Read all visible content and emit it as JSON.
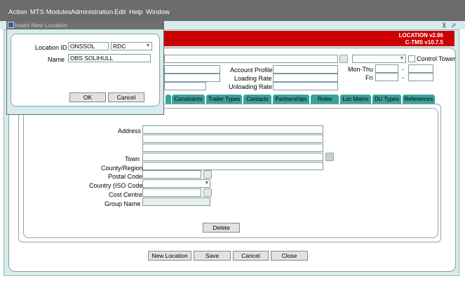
{
  "menubar": {
    "items": [
      "Action",
      "MTS Modules",
      "Administration",
      "Edit",
      "Help",
      "Window"
    ]
  },
  "controls": {
    "minimize_icon": "window-minimize-icon",
    "restore_icon": "window-restore-icon"
  },
  "header": {
    "module_name": "LOCATION v2.86",
    "system_version": "C-TMS v10.7.5"
  },
  "form": {
    "control_tower_label": "Control Tower",
    "account_profile_label": "Account Profile",
    "loading_rate_label": "Loading Rate",
    "unloading_rate_label": "Unloading Rate",
    "mon_thu_label": "Mon-Thu",
    "fri_label": "Fri",
    "dash": "-"
  },
  "tabs": [
    "Constraints",
    "Trailer Types",
    "Contacts",
    "Partnerships",
    "Roles",
    "Loc Matrix",
    "DU Types",
    "References"
  ],
  "address": {
    "address_label": "Address",
    "town_label": "Town",
    "county_label": "County/Region",
    "postal_code_label": "Postal Code",
    "country_label": "Country (ISO Code)",
    "cost_centre_label": "Cost Centre",
    "group_name_label": "Group Name",
    "delete_label": "Delete"
  },
  "footer": {
    "new_location_label": "New Location",
    "save_label": "Save",
    "cancel_label": "Cancel",
    "close_label": "Close"
  },
  "dialog": {
    "title": "Insert New Location",
    "location_id_label": "Location ID",
    "location_id_value": "ONSSOL",
    "location_type_value": "RDC",
    "name_label": "Name",
    "name_value": "OBS SOLIHULL",
    "ok_label": "OK",
    "cancel_label": "Cancel"
  }
}
